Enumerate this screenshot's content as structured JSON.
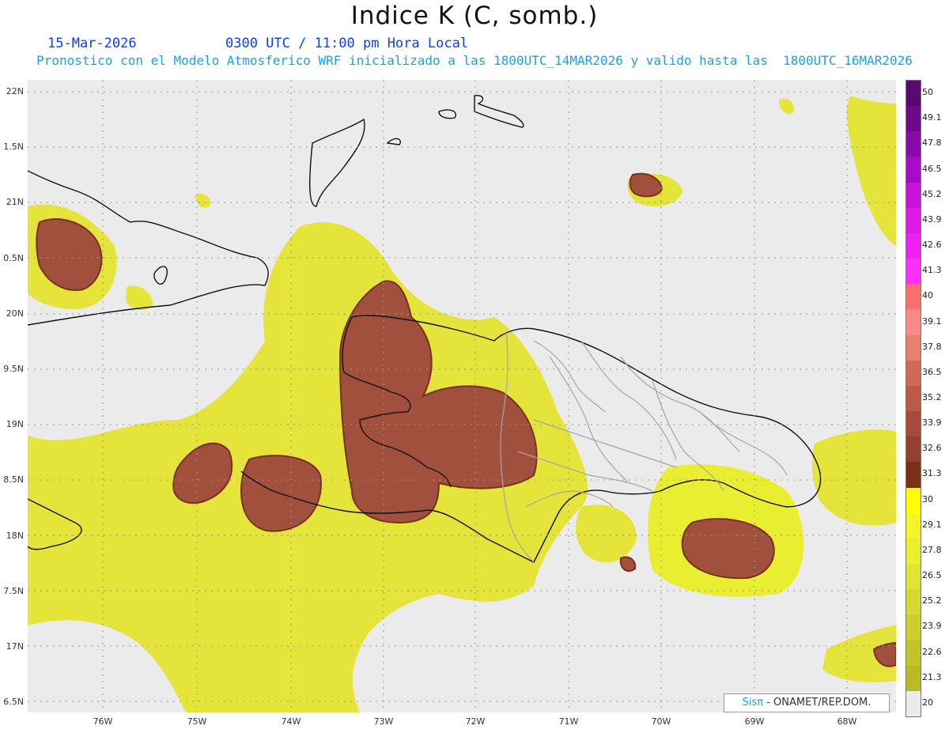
{
  "header": {
    "title": "Indice K (C, somb.)",
    "date": "15-Mar-2026",
    "time": "0300 UTC / 11:00 pm Hora Local",
    "forecast": "Pronostico con el Modelo Atmosferico WRF inicializado a las 1800UTC_14MAR2026 y valido hasta las  1800UTC_16MAR2026"
  },
  "map": {
    "lat_labels": [
      "22N",
      "1.5N",
      "21N",
      "0.5N",
      "20N",
      "9.5N",
      "19N",
      "8.5N",
      "18N",
      "7.5N",
      "17N",
      "6.5N"
    ],
    "lon_labels": [
      "76W",
      "75W",
      "74W",
      "73W",
      "72W",
      "71W",
      "70W",
      "69W",
      "68W"
    ],
    "background_color": "#ebebeb",
    "coastline_color": "#111111",
    "border_color": "#a6a6a6"
  },
  "colorbar": {
    "labels": [
      "50",
      "49.1",
      "47.8",
      "46.5",
      "45.2",
      "43.9",
      "42.6",
      "41.3",
      "40",
      "39.1",
      "37.8",
      "36.5",
      "35.2",
      "33.9",
      "32.6",
      "31.3",
      "30",
      "29.1",
      "27.8",
      "26.5",
      "25.2",
      "23.9",
      "22.6",
      "21.3",
      "20"
    ],
    "colors": [
      "#5a0a6e",
      "#6e0a88",
      "#8a0aa8",
      "#a80cc8",
      "#c814d8",
      "#e01ae6",
      "#f020f0",
      "#ff30ff",
      "#ff6f6f",
      "#ff8888",
      "#e8806e",
      "#d06a58",
      "#bc5a48",
      "#a84a3a",
      "#94402e",
      "#7a3216",
      "#ffff00",
      "#f4f428",
      "#eaef30",
      "#e0e436",
      "#d6d932",
      "#ccce2e",
      "#c2c42a",
      "#b8ba26",
      "#ebebeb"
    ]
  },
  "credit": {
    "logo": "Sisπ",
    "text": "- ONAMET/REP.DOM."
  }
}
